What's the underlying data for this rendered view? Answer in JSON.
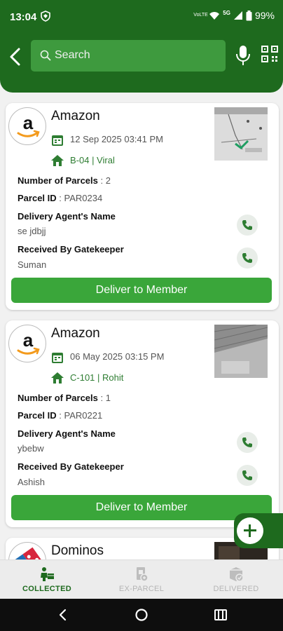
{
  "status_bar": {
    "time": "13:04",
    "battery": "99%",
    "network": "5G",
    "volte": "VoLTE"
  },
  "header": {
    "search_placeholder": "Search"
  },
  "parcels": [
    {
      "vendor": "Amazon",
      "date": "12 Sep 2025 03:41 PM",
      "flat": "B-04 | Viral",
      "num_parcels_label": "Number of Parcels",
      "num_parcels": ": 2",
      "parcel_id_label": "Parcel ID",
      "parcel_id": ": PAR0234",
      "agent_label": "Delivery Agent's Name",
      "agent": "se jdbjj",
      "gatekeeper_label": "Received By Gatekeeper",
      "gatekeeper": "Suman",
      "action": "Deliver to Member"
    },
    {
      "vendor": "Amazon",
      "date": "06 May 2025 03:15 PM",
      "flat": "C-101 | Rohit",
      "num_parcels_label": "Number of Parcels",
      "num_parcels": ": 1",
      "parcel_id_label": "Parcel ID",
      "parcel_id": ": PAR0221",
      "agent_label": "Delivery Agent's Name",
      "agent": "ybebw",
      "gatekeeper_label": "Received By Gatekeeper",
      "gatekeeper": "Ashish",
      "action": "Deliver to Member"
    },
    {
      "vendor": "Dominos"
    }
  ],
  "bottom_nav": [
    {
      "label": "COLLECTED",
      "icon": "collected-parcel-icon",
      "active": true
    },
    {
      "label": "EX-PARCEL",
      "icon": "ex-parcel-icon",
      "active": false
    },
    {
      "label": "DELIVERED",
      "icon": "delivered-parcel-icon",
      "active": false
    }
  ],
  "colors": {
    "header": "#1e6a1e",
    "button": "#3aa63a",
    "accent_text": "#2e7d32"
  }
}
